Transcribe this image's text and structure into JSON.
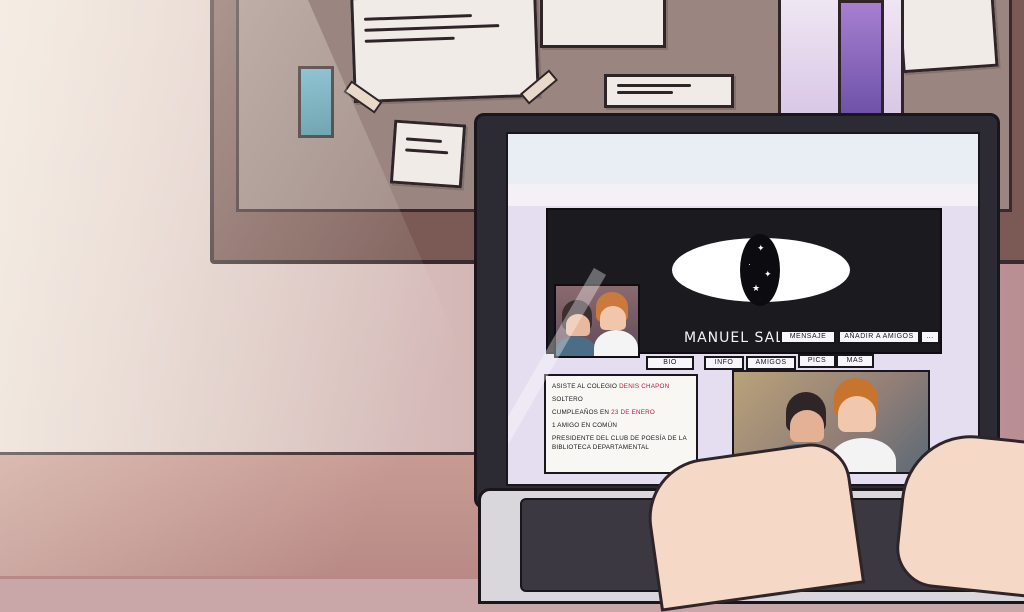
{
  "profile": {
    "name": "MANUEL SALAS",
    "actions": {
      "message": "MENSAJE",
      "add_friends": "AÑADIR A AMIGOS",
      "more": "..."
    },
    "tabs": [
      "BIO",
      "INFO",
      "AMIGOS",
      "PICS",
      "MAS"
    ],
    "info": {
      "school_prefix": "ASISTE AL COLEGIO ",
      "school": "DENIS CHAPON",
      "status": "SOLTERO",
      "birthday_prefix": "CUMPLEAÑOS EN ",
      "birthday": "23 DE ENERO",
      "mutual": "1 AMIGO EN COMÚN",
      "role": "PRESIDENTE DEL CLUB DE POESÍA DE LA BIBLIOTECA DEPARTAMENTAL"
    }
  },
  "colors": {
    "banner": "#1b1a1f",
    "page_bg": "#e4def0",
    "highlight": "#b71d3a"
  },
  "icons": {
    "banner_art": "eye-icon",
    "more": "more-icon"
  }
}
